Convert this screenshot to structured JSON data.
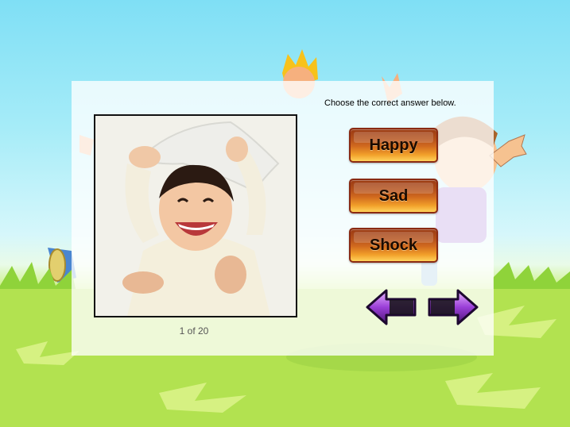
{
  "quiz": {
    "prompt": "Choose the correct answer below.",
    "answers": [
      "Happy",
      "Sad",
      "Shock"
    ],
    "progress": "1 of 20"
  },
  "colors": {
    "sky": "#7fdff5",
    "grass": "#a7e04c",
    "button_dark": "#8a2a12",
    "button_light": "#ffd35c",
    "arrow_purple": "#9b3fd8"
  },
  "icons": {
    "previous": "left-arrow-icon",
    "next": "right-arrow-icon"
  }
}
